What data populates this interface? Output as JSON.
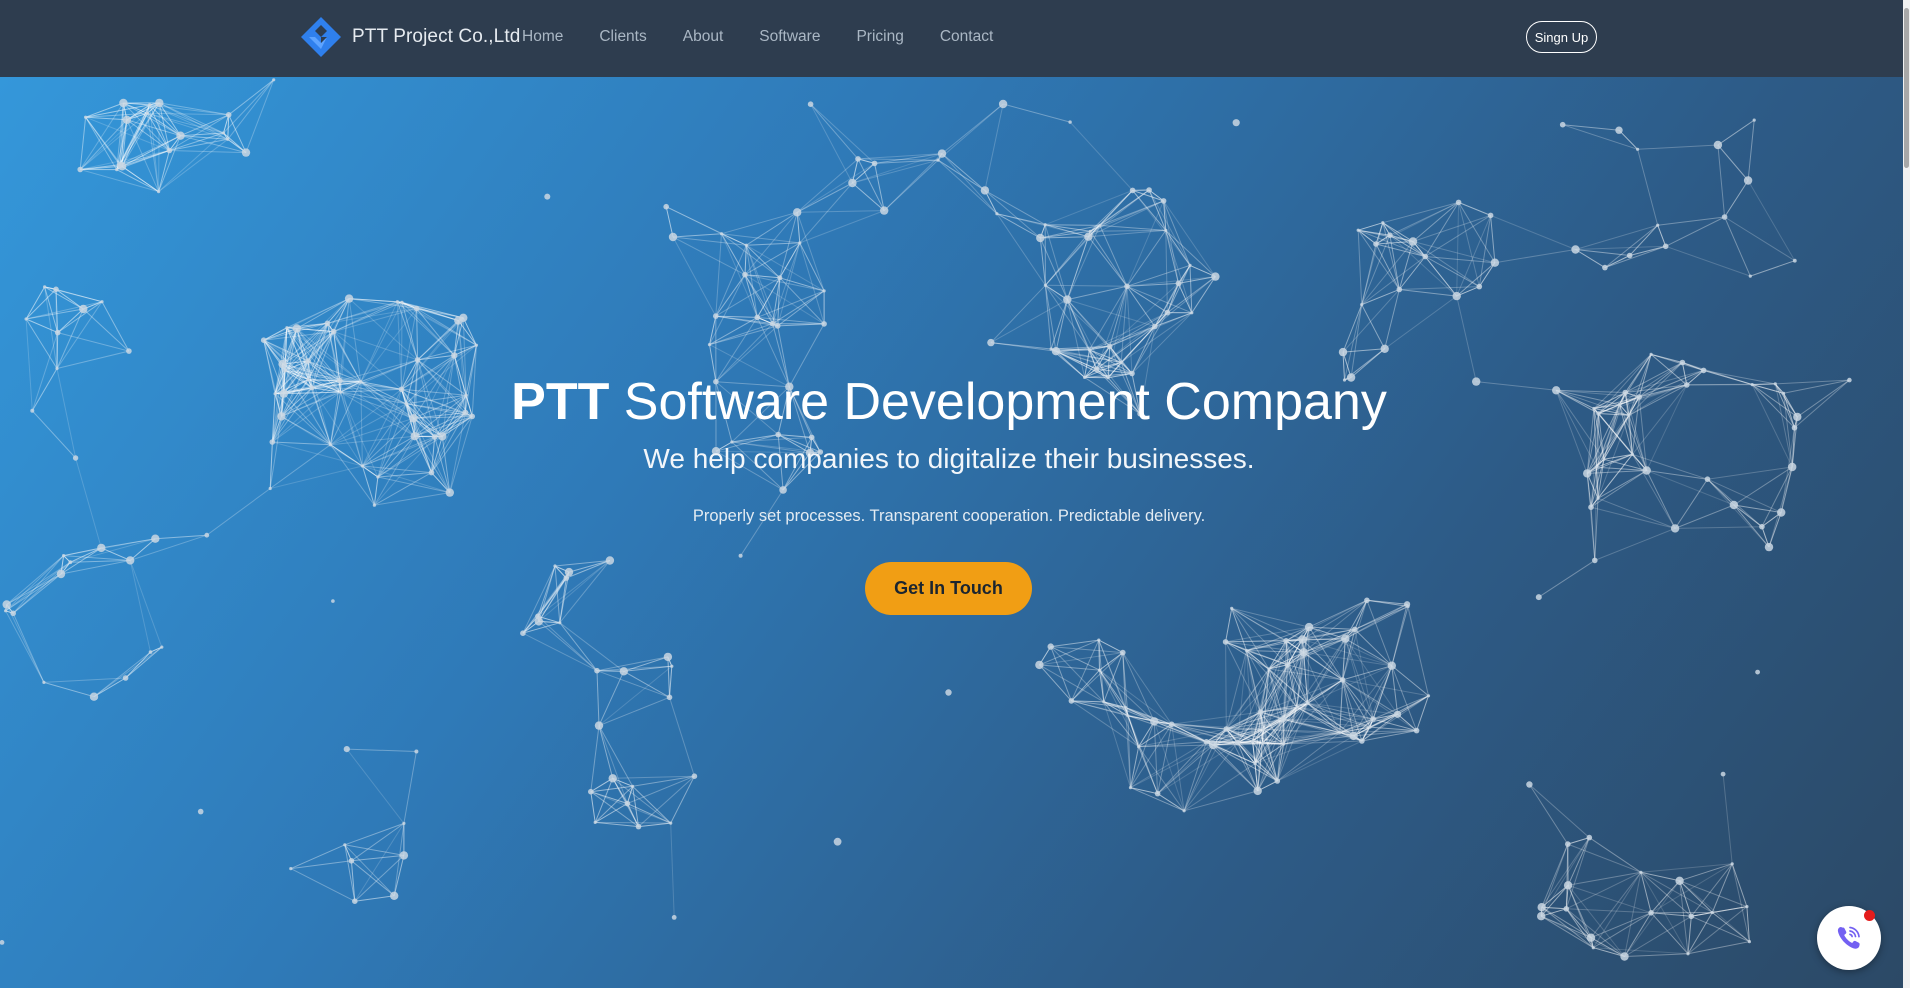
{
  "brand": {
    "name": "PTT Project Co.,Ltd",
    "logo_icon": "blue-diamond-logo-icon",
    "logo_color": "#2f80ed"
  },
  "nav": {
    "items": [
      {
        "label": "Home"
      },
      {
        "label": "Clients"
      },
      {
        "label": "About"
      },
      {
        "label": "Software"
      },
      {
        "label": "Pricing"
      },
      {
        "label": "Contact"
      }
    ],
    "signup_label": "Singn Up"
  },
  "hero": {
    "title_strong": "PTT",
    "title_rest": " Software Development Company",
    "subtitle": "We help companies to digitalize their businesses.",
    "tagline": "Properly set processes. Transparent cooperation. Predictable delivery.",
    "cta_label": "Get In Touch",
    "background": "particle-network",
    "gradient_start": "#3497da",
    "gradient_end": "#2c4966"
  },
  "widget": {
    "icon": "viber-phone-icon",
    "icon_color": "#7360f2",
    "notification_color": "#e41c1c"
  },
  "colors": {
    "navbar": "#2e3d4f",
    "accent": "#f19e14"
  }
}
